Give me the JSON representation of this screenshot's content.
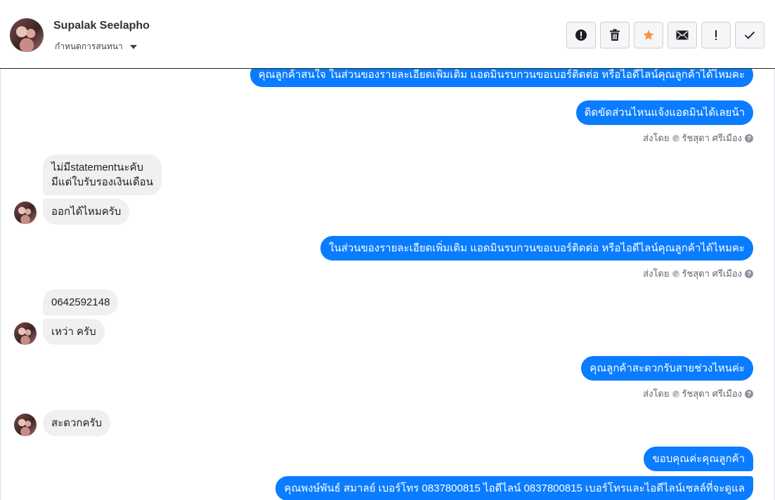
{
  "header": {
    "name": "Supalak Seelapho",
    "conversation_tag": "กำหนดการสนทนา",
    "actions": [
      {
        "name": "report-spam",
        "icon": "alert-circle-icon"
      },
      {
        "name": "delete",
        "icon": "trash-icon"
      },
      {
        "name": "star",
        "icon": "star-icon",
        "color": "#f7923b"
      },
      {
        "name": "mark-unread",
        "icon": "envelope-icon"
      },
      {
        "name": "follow-up",
        "icon": "exclamation-icon"
      },
      {
        "name": "mark-done",
        "icon": "check-icon"
      }
    ]
  },
  "colors": {
    "outgoing_bubble": "#0a7cff",
    "incoming_bubble": "#f0f0f0",
    "star": "#f7923b"
  },
  "messages": {
    "out1": "คุณลูกค้าสนใจ ในส่วนของรายละเอียดเพิ่มเติม แอดมินรบกวนขอเบอร์ติดต่อ หรือไอดีไลน์คุณลูกค้าได้ไหมคะ",
    "out2": "ติดขัดส่วนไหนแจ้งแอดมินได้เลยน้า",
    "in1_line1": "ไม่มีstatementนะคับ",
    "in1_line2": "มีแต่ใบรับรองเงินเดือน",
    "in2": "ออกได้ไหมครับ",
    "out3": "ในส่วนของรายละเอียดเพิ่มเติม แอดมินรบกวนขอเบอร์ติดต่อ หรือไอดีไลน์คุณลูกค้าได้ไหมคะ",
    "in3": "0642592148",
    "in4": "เหว่า ครับ",
    "out4": "คุณลูกค้าสะดวกรับสายช่วงไหนค่ะ",
    "in5": "สะดวกครับ",
    "out5": "ขอบคุณค่ะคุณลูกค้า",
    "out6": "คุณพงษ์พันธ์ สมาลย์      เบอร์โทร 0837800815  ไอดีไลน์ 0837800815   เบอร์โทรและไอดีไลน์เซลล์ที่จะดูแล"
  },
  "sent_by": {
    "prefix": "ส่งโดย",
    "agent": "รัชสุดา ศรีเมือง",
    "help": "?"
  }
}
